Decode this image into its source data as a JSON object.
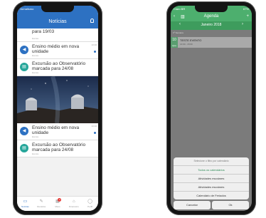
{
  "phone1": {
    "status_left": "Jornalismo",
    "title": "Notícias",
    "cards": [
      {
        "text": "para 19/03",
        "small": "Escola",
        "time": ""
      },
      {
        "text": "Ensino médio em nova unidade",
        "small": "Escola",
        "time": "13:16"
      },
      {
        "text": "Excursão ao Observatório marcada para 24/08",
        "small": "Escola",
        "time": ""
      },
      {
        "text": "Ensino médio em nova unidade",
        "small": "Escola",
        "time": "13:16"
      },
      {
        "text": "Excursão ao Observatório marcada para 24/08",
        "small": "Escola",
        "time": ""
      }
    ],
    "tabs": [
      {
        "label": "Notícias",
        "icon": "▭"
      },
      {
        "label": "Recados",
        "icon": "✎"
      },
      {
        "label": "Meus",
        "icon": "▦",
        "badge": "2"
      },
      {
        "label": "Financeiro",
        "icon": "⌂"
      },
      {
        "label": "Perfil",
        "icon": "◯"
      }
    ]
  },
  "phone2": {
    "status_left": "Claro BR",
    "status_right": "67%",
    "title": "Agenda",
    "month": "Janeiro 2018",
    "section": "1ª Semana",
    "event": {
      "day": "10",
      "weekday": "Qua",
      "title": "TESTE EVENTO",
      "subtitle": "14:00 - 15:00"
    },
    "sheet": {
      "header": "Selecione o filtro por calendário",
      "options": [
        "Todos os calendários",
        "Atividades escolares",
        "Atividades escolares",
        "Calendário de Feriados"
      ],
      "cancel": "Cancelar",
      "ok": "Ok"
    }
  }
}
